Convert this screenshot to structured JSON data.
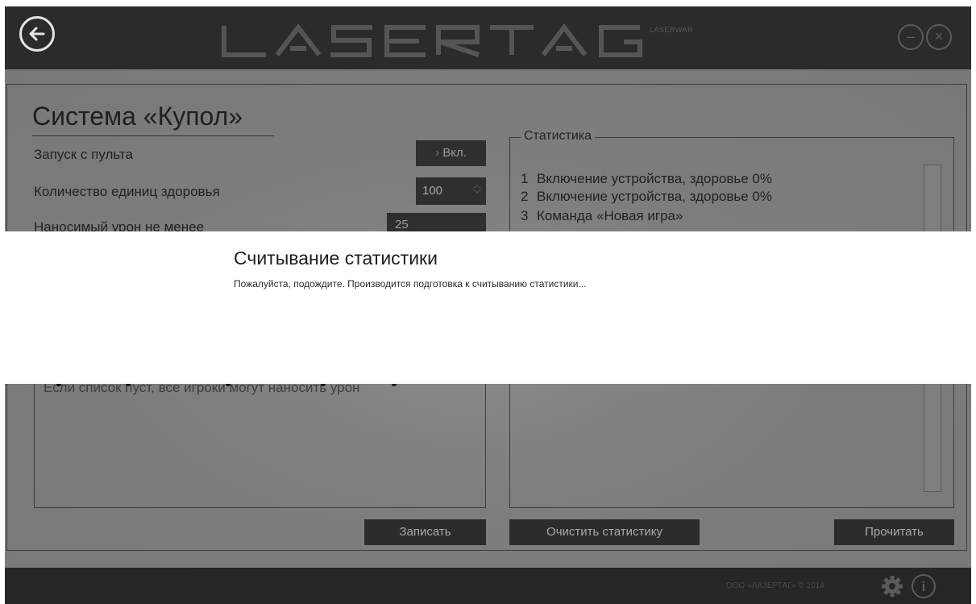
{
  "header": {
    "logo_text": "LASERTAG",
    "logo_sub": "LASERWAR"
  },
  "page": {
    "title": "Система «Купол»"
  },
  "settings": {
    "remote_start_label": "Запуск с пульта",
    "remote_start_value": "Вкл.",
    "health_label": "Количество единиц здоровья",
    "health_value": "100",
    "damage_label": "Наносимый урон не менее",
    "damage_value": "25"
  },
  "players": {
    "empty_text": "Если список пуст, все игроки могут наносить урон"
  },
  "stats": {
    "legend": "Статистика",
    "entries": [
      {
        "num": "1",
        "text": "Включение устройства, здоровье 0%"
      },
      {
        "num": "2",
        "text": "Включение устройства, здоровье 0%"
      },
      {
        "num": "3",
        "text": "Команда «Новая игра»"
      }
    ]
  },
  "buttons": {
    "write": "Записать",
    "clear": "Очистить статистику",
    "read": "Прочитать"
  },
  "footer": {
    "copyright": "ООО «ЛАЗЕРТАГ» © 2014"
  },
  "modal": {
    "title": "Считывание статистики",
    "message": "Пожалуйста, подождите. Производится подготовка к считыванию статистики..."
  },
  "icons": {
    "back": "back-arrow-icon",
    "minimize": "minimize-icon",
    "close": "close-icon",
    "settings": "gear-icon",
    "info": "info-icon"
  }
}
